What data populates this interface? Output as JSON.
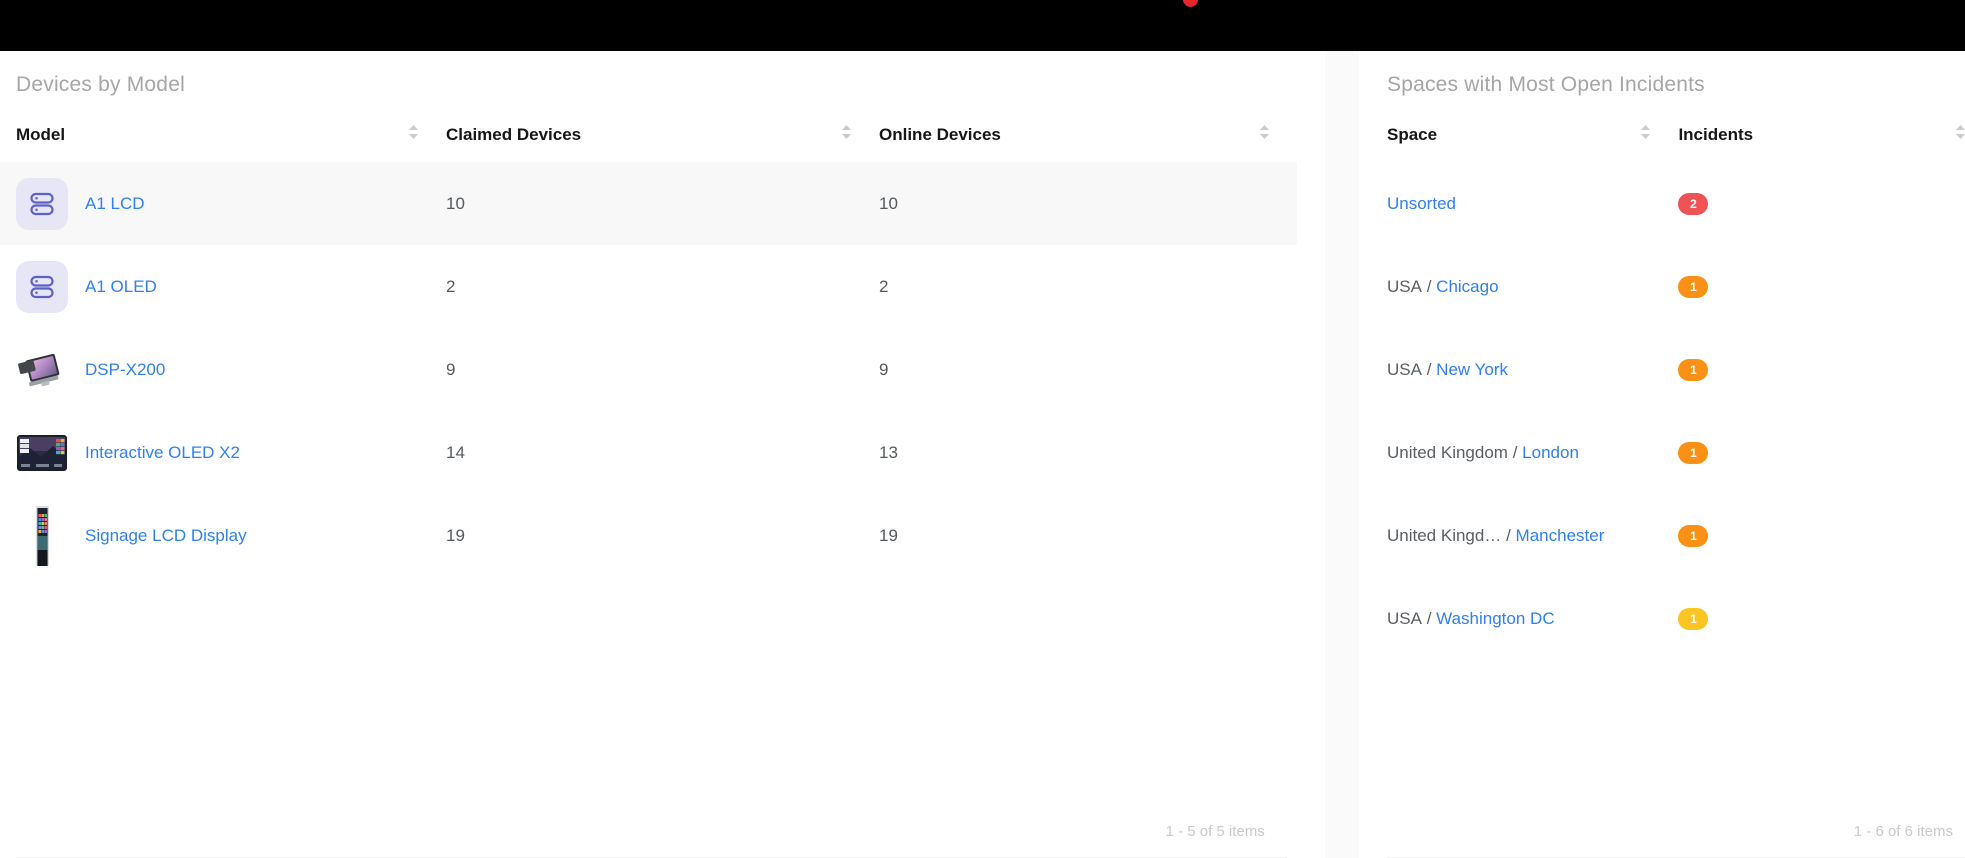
{
  "topbar": {
    "notification_badge_color": "#e8242c"
  },
  "devices_panel": {
    "title": "Devices by Model",
    "columns": [
      {
        "label": "Model",
        "sortable": true
      },
      {
        "label": "Claimed Devices",
        "sortable": true
      },
      {
        "label": "Online Devices",
        "sortable": true
      }
    ],
    "rows": [
      {
        "model": "A1 LCD",
        "icon": "server-icon",
        "claimed": "10",
        "online": "10",
        "highlighted": true
      },
      {
        "model": "A1 OLED",
        "icon": "server-icon",
        "claimed": "2",
        "online": "2",
        "highlighted": false
      },
      {
        "model": "DSP-X200",
        "icon": "dsp-x200-thumbnail",
        "claimed": "9",
        "online": "9",
        "highlighted": false
      },
      {
        "model": "Interactive OLED X2",
        "icon": "interactive-oled-thumbnail",
        "claimed": "14",
        "online": "13",
        "highlighted": false
      },
      {
        "model": "Signage LCD Display",
        "icon": "signage-lcd-thumbnail",
        "claimed": "19",
        "online": "19",
        "highlighted": false
      }
    ],
    "footer": "1 - 5 of 5 items"
  },
  "incidents_panel": {
    "title": "Spaces with Most Open Incidents",
    "columns": [
      {
        "label": "Space",
        "sortable": true
      },
      {
        "label": "Incidents",
        "sortable": true
      }
    ],
    "rows": [
      {
        "parent": "",
        "separator": "",
        "space": "Unsorted",
        "count": "2",
        "badge_color": "#ee5455"
      },
      {
        "parent": "USA",
        "separator": "/",
        "space": "Chicago",
        "count": "1",
        "badge_color": "#fa9016"
      },
      {
        "parent": "USA",
        "separator": "/",
        "space": "New York",
        "count": "1",
        "badge_color": "#fa9016"
      },
      {
        "parent": "United Kingdom",
        "separator": "/",
        "space": "London",
        "count": "1",
        "badge_color": "#fa9016"
      },
      {
        "parent": "United Kingd…",
        "separator": "/",
        "space": "Manchester",
        "count": "1",
        "badge_color": "#fa9016"
      },
      {
        "parent": "USA",
        "separator": "/",
        "space": "Washington DC",
        "count": "1",
        "badge_color": "#fbc624"
      }
    ],
    "footer": "1 - 6 of 6 items"
  },
  "colors": {
    "link": "#2f80ed",
    "title": "#a6a6a6",
    "header_text": "#161616",
    "cell_text": "#555a5e",
    "row_highlight": "#f8f8f8",
    "topbar": "#000000"
  }
}
